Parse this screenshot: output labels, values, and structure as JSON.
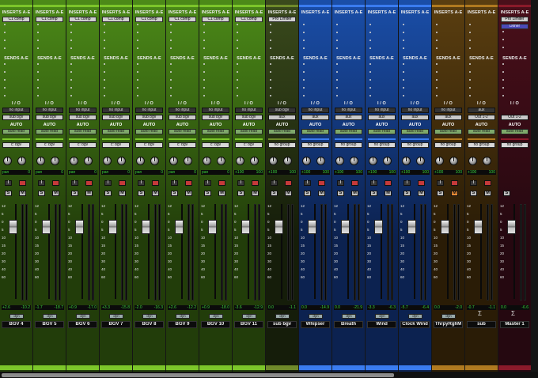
{
  "labels": {
    "inserts": "INSERTS A-E",
    "sends": "SENDS A-E",
    "io": "I / O",
    "auto": "AUTO",
    "dyn": "dyn",
    "sigma": "Σ"
  },
  "colors": {
    "green": "#4c8a18",
    "green_dark": "#223d0a",
    "green_accent": "#7cc62a",
    "olive": "#3a4a1c",
    "olive_dark": "#151d0a",
    "olive_accent": "#6f8a2a",
    "blue": "#1a4ea8",
    "blue_dark": "#0c2250",
    "blue_accent": "#3a7cf0",
    "brown": "#5a3e10",
    "brown_dark": "#2a1c06",
    "brown_accent": "#b07a20",
    "maroon": "#4a0f1a",
    "maroon_dark": "#250810",
    "maroon_accent": "#8a1a2a"
  },
  "fader_scale": [
    "12",
    "5",
    "0",
    "5",
    "10",
    "15",
    "20",
    "30",
    "40",
    "60"
  ],
  "tracks": [
    {
      "name": "BGV 4",
      "theme": "green",
      "inserts": [
        "C1 comp"
      ],
      "io_in": "no input",
      "io_out": "sub bgv",
      "auto": "auto read",
      "group": "c: bgv",
      "pan_label": "pan",
      "pan_value": "0",
      "vol_a": "+2.6",
      "vol_b": "-10.2"
    },
    {
      "name": "BGV 5",
      "theme": "green",
      "inserts": [
        "C1 comp"
      ],
      "io_in": "no input",
      "io_out": "sub bgv",
      "auto": "auto read",
      "group": "c: bgv",
      "pan_label": "pan",
      "pan_value": "0",
      "vol_a": "-1.7",
      "vol_b": "-18.7"
    },
    {
      "name": "BGV 6",
      "theme": "green",
      "inserts": [
        "C1 comp"
      ],
      "io_in": "no input",
      "io_out": "sub bgv",
      "auto": "auto read",
      "group": "c: bgv",
      "pan_label": "pan",
      "pan_value": "0",
      "vol_a": "+0.9",
      "vol_b": "-17.0"
    },
    {
      "name": "BGV 7",
      "theme": "green",
      "inserts": [
        "C1 comp"
      ],
      "io_in": "no input",
      "io_out": "sub bgv",
      "auto": "auto read",
      "group": "c: bgv",
      "pan_label": "pan",
      "pan_value": "0",
      "vol_a": "+3.3",
      "vol_b": "-15.8"
    },
    {
      "name": "BGV 8",
      "theme": "green",
      "inserts": [
        "C1 comp"
      ],
      "io_in": "no input",
      "io_out": "sub bgv",
      "auto": "auto read",
      "group": "c: bgv",
      "pan_label": "pan",
      "pan_value": "0",
      "vol_a": "-2.0",
      "vol_b": "-16.3"
    },
    {
      "name": "BGV 9",
      "theme": "green",
      "inserts": [
        "C1 comp"
      ],
      "io_in": "no input",
      "io_out": "sub bgv",
      "auto": "auto read",
      "group": "c: bgv",
      "pan_label": "pan",
      "pan_value": "0",
      "vol_a": "+2.6",
      "vol_b": "-12.2"
    },
    {
      "name": "BGV 10",
      "theme": "green",
      "inserts": [
        "C1 comp"
      ],
      "io_in": "no input",
      "io_out": "sub bgv",
      "auto": "auto read",
      "group": "c: bgv",
      "pan_label": "pan",
      "pan_value": "0",
      "vol_a": "+0.9",
      "vol_b": "-18.0"
    },
    {
      "name": "BGV 11",
      "theme": "green",
      "inserts": [
        "C1 comp"
      ],
      "io_in": "no input",
      "io_out": "sub bgv",
      "auto": "auto read",
      "group": "c: bgv",
      "pan_label": "+100",
      "pan_value": "100",
      "vol_a": "-3.6",
      "vol_b": "-12.9"
    },
    {
      "name": "sub bgv",
      "theme": "olive",
      "inserts": [
        "Pro Limiter"
      ],
      "io_in": "sub bgv",
      "io_out": "aux",
      "auto": "auto read",
      "group": "no group",
      "pan_label": "+100",
      "pan_value": "100",
      "vol_a": "0.0",
      "vol_b": "-1.1"
    },
    {
      "name": "Whipser",
      "theme": "blue",
      "inserts": [],
      "io_in": "no input",
      "io_out": "aux",
      "auto": "auto read",
      "group": "no group",
      "pan_label": "+100",
      "pan_value": "100",
      "vol_a": "0.0",
      "vol_b": "-14.9"
    },
    {
      "name": "Breath",
      "theme": "blue",
      "inserts": [],
      "io_in": "no input",
      "io_out": "aux",
      "auto": "auto read",
      "group": "no group",
      "pan_label": "+100",
      "pan_value": "100",
      "vol_a": "0.0",
      "vol_b": "-21.9"
    },
    {
      "name": "Wind",
      "theme": "blue",
      "inserts": [],
      "io_in": "no input",
      "io_out": "aux",
      "auto": "auto read",
      "group": "no group",
      "pan_label": "+100",
      "pan_value": "100",
      "vol_a": "-3.3",
      "vol_b": "-6.3"
    },
    {
      "name": "Clock Wind",
      "theme": "blue",
      "inserts": [],
      "io_in": "no input",
      "io_out": "aux",
      "auto": "auto read",
      "group": "no group",
      "pan_label": "+100",
      "pan_value": "100",
      "vol_a": "-5.7",
      "vol_b": "-6.4"
    },
    {
      "name": "ThrpyRghM",
      "theme": "brown",
      "inserts": [],
      "io_in": "no input",
      "io_out": "aux",
      "auto": "auto read",
      "group": "no group",
      "pan_label": "+100",
      "pan_value": "100",
      "vol_a": "0.0",
      "vol_b": "-2.0",
      "mute_on": true
    },
    {
      "name": "sub",
      "theme": "brown",
      "inserts": [],
      "io_in": "aux",
      "io_out": "Out 1-2",
      "auto": "auto read",
      "group": "no group",
      "pan_label": "+100",
      "pan_value": "100",
      "vol_a": "-0.7",
      "vol_b": "-1.1",
      "sigma": true
    },
    {
      "name": "Master 1",
      "theme": "maroon",
      "inserts": [
        "Pro Limiter",
        "Dither"
      ],
      "io_in": "",
      "io_out": "Out 1-2",
      "auto": "auto read",
      "group": "no group",
      "pan_label": "",
      "pan_value": "",
      "vol_a": "0.0",
      "vol_b": "-6.6",
      "master": true,
      "sigma": true
    }
  ]
}
